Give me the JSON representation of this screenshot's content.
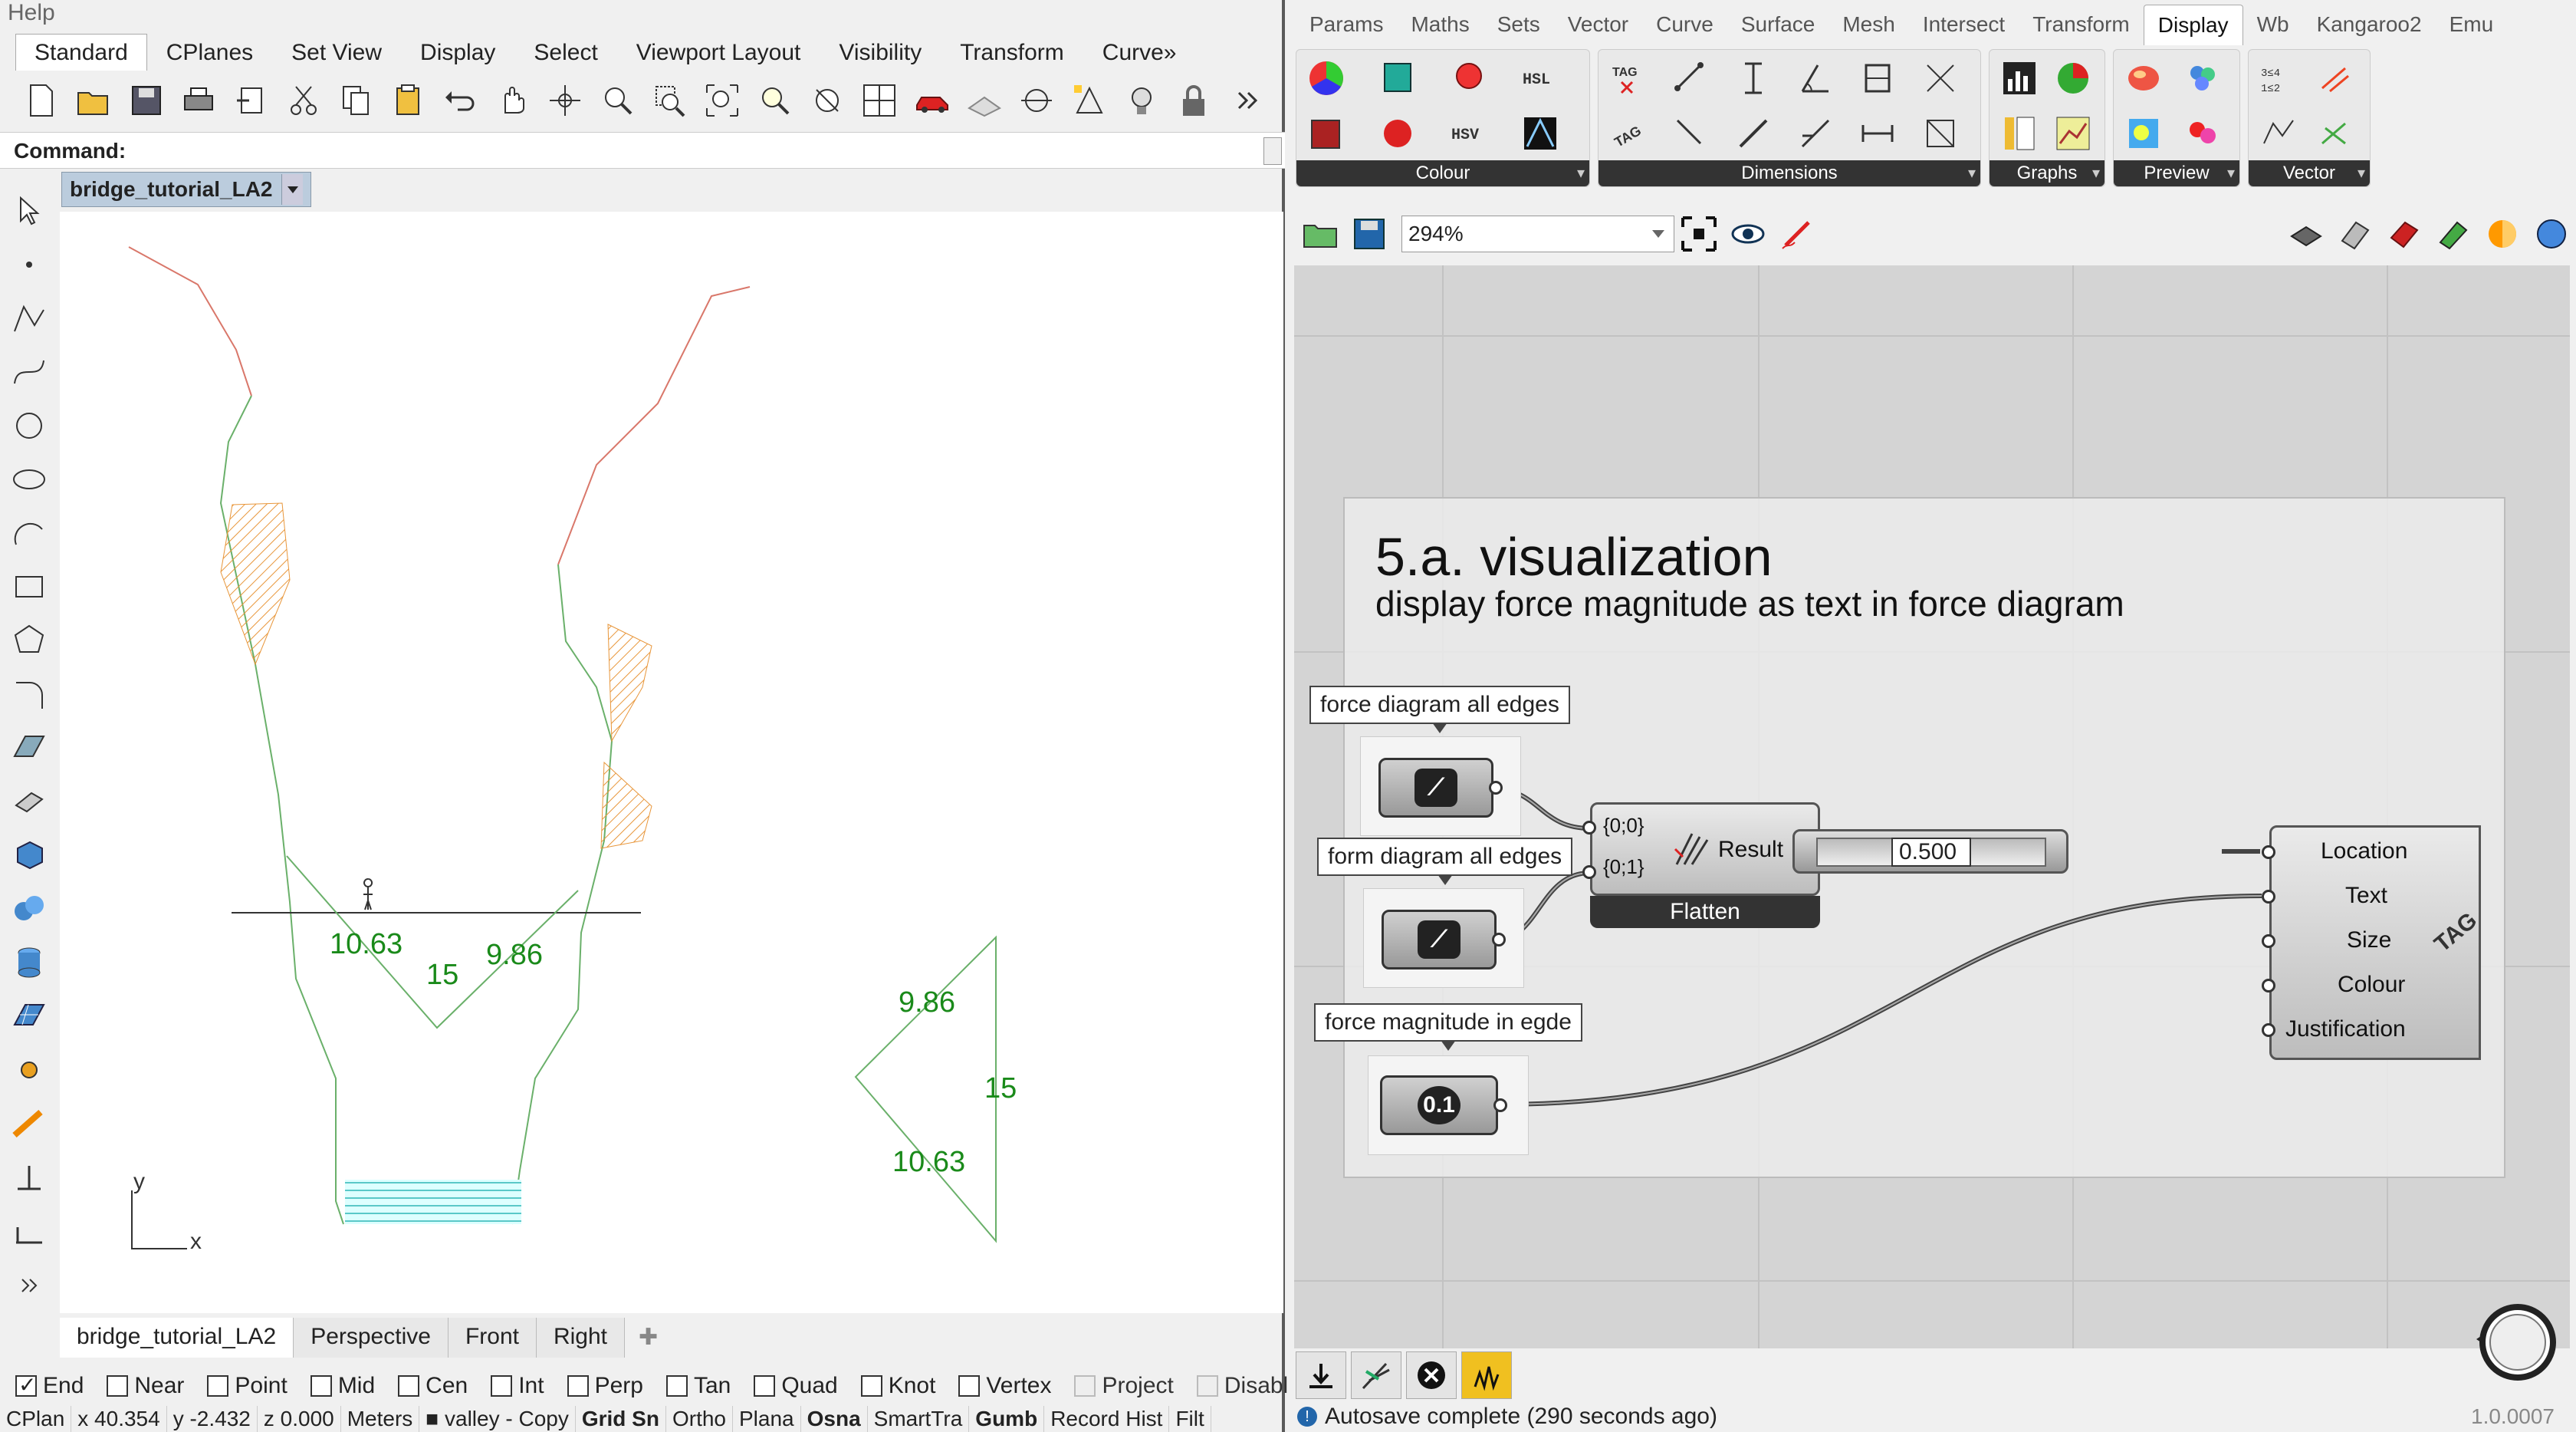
{
  "rhino": {
    "menu": "Help",
    "tabs": [
      "Standard",
      "CPlanes",
      "Set View",
      "Display",
      "Select",
      "Viewport Layout",
      "Visibility",
      "Transform",
      "Curve»"
    ],
    "command_label": "Command:",
    "viewport_title": "bridge_tutorial_LA2",
    "labels_section": [
      "10.63",
      "15",
      "9.86"
    ],
    "labels_force": [
      "9.86",
      "15",
      "10.63"
    ],
    "axis_x": "x",
    "axis_y": "y",
    "viewport_tabs": [
      "bridge_tutorial_LA2",
      "Perspective",
      "Front",
      "Right"
    ],
    "osnaps": [
      {
        "label": "End",
        "checked": true,
        "disabled": false
      },
      {
        "label": "Near",
        "checked": false,
        "disabled": false
      },
      {
        "label": "Point",
        "checked": false,
        "disabled": false
      },
      {
        "label": "Mid",
        "checked": false,
        "disabled": false
      },
      {
        "label": "Cen",
        "checked": false,
        "disabled": false
      },
      {
        "label": "Int",
        "checked": false,
        "disabled": false
      },
      {
        "label": "Perp",
        "checked": false,
        "disabled": false
      },
      {
        "label": "Tan",
        "checked": false,
        "disabled": false
      },
      {
        "label": "Quad",
        "checked": false,
        "disabled": false
      },
      {
        "label": "Knot",
        "checked": false,
        "disabled": false
      },
      {
        "label": "Vertex",
        "checked": false,
        "disabled": false
      },
      {
        "label": "Project",
        "checked": false,
        "disabled": true
      },
      {
        "label": "Disable",
        "checked": false,
        "disabled": true
      }
    ],
    "status": {
      "cplane": "CPlan",
      "x": "x 40.354",
      "y": "y -2.432",
      "z": "z 0.000",
      "units": "Meters",
      "layer": "valley - Copy",
      "grid_snap": "Grid Sn",
      "ortho": "Ortho",
      "planar": "Plana",
      "osnap": "Osna",
      "smarttrack": "SmartTra",
      "gumball": "Gumb",
      "record_history": "Record Hist",
      "filter": "Filt"
    }
  },
  "grasshopper": {
    "tabs": [
      "Params",
      "Maths",
      "Sets",
      "Vector",
      "Curve",
      "Surface",
      "Mesh",
      "Intersect",
      "Transform",
      "Display",
      "Wb",
      "Kangaroo2",
      "Emu"
    ],
    "active_tab": "Display",
    "ribbon_groups": [
      "Colour",
      "Dimensions",
      "Graphs",
      "Preview",
      "Vector"
    ],
    "ribbon_text_icons": {
      "hsl": "HSL",
      "hsv": "HSV",
      "tag": "TAG"
    },
    "zoom": "294%",
    "group_title": "5.a. visualization",
    "group_subtitle": "display force magnitude as text in force diagram",
    "balloons": [
      "force diagram all edges",
      "form diagram all edges",
      "force magnitude in egde"
    ],
    "number_param_icon": "0.1",
    "flatten": {
      "inputs": [
        "{0;0}",
        "{0;1}"
      ],
      "output": "Result",
      "name": "Flatten"
    },
    "slider_value": "0.500",
    "tag_inputs": [
      "Location",
      "Text",
      "Size",
      "Colour",
      "Justification"
    ],
    "tag_watermark": "TAG",
    "status": "Autosave complete (290 seconds ago)",
    "version": "1.0.0007"
  },
  "colors": {
    "terrain_red": "#d9776a",
    "terrain_green": "#6ab06a",
    "hatch_orange": "#e8963a",
    "water": "#5ac8c8",
    "label_green": "#1a8a1a"
  }
}
